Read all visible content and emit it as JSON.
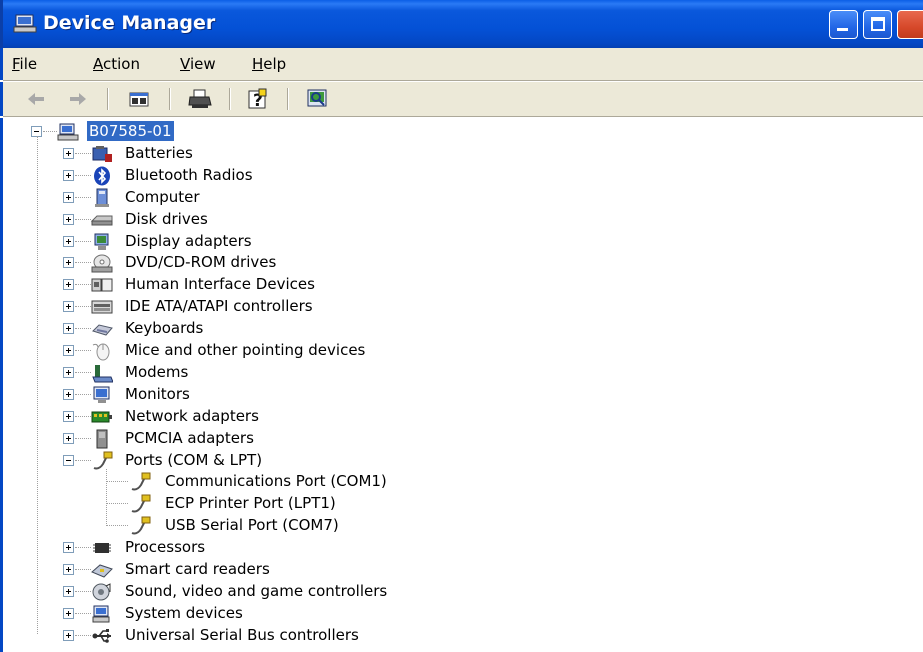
{
  "window": {
    "title": "Device Manager",
    "colors": {
      "titlebar": "#0451d6",
      "selection": "#316ac5",
      "chrome": "#ece9d8"
    }
  },
  "menu": [
    "File",
    "Action",
    "View",
    "Help"
  ],
  "toolbar": [
    "back-arrow-icon",
    "forward-arrow-icon",
    "show-hide-console-tree-icon",
    "print-icon",
    "help-icon",
    "scan-hardware-icon"
  ],
  "tree": {
    "root": "B07585-01",
    "categories": [
      {
        "label": "Batteries",
        "icon": "battery-icon"
      },
      {
        "label": "Bluetooth Radios",
        "icon": "bluetooth-icon"
      },
      {
        "label": "Computer",
        "icon": "computer-icon"
      },
      {
        "label": "Disk drives",
        "icon": "disk-drive-icon"
      },
      {
        "label": "Display adapters",
        "icon": "display-adapter-icon"
      },
      {
        "label": "DVD/CD-ROM drives",
        "icon": "cd-drive-icon"
      },
      {
        "label": "Human Interface Devices",
        "icon": "hid-icon"
      },
      {
        "label": "IDE ATA/ATAPI controllers",
        "icon": "ide-controller-icon"
      },
      {
        "label": "Keyboards",
        "icon": "keyboard-icon"
      },
      {
        "label": "Mice and other pointing devices",
        "icon": "mouse-icon"
      },
      {
        "label": "Modems",
        "icon": "modem-icon"
      },
      {
        "label": "Monitors",
        "icon": "monitor-icon"
      },
      {
        "label": "Network adapters",
        "icon": "network-adapter-icon"
      },
      {
        "label": "PCMCIA adapters",
        "icon": "pcmcia-icon"
      },
      {
        "label": "Ports (COM & LPT)",
        "icon": "port-icon",
        "expanded": true,
        "children": [
          {
            "label": "Communications Port (COM1)",
            "icon": "port-icon"
          },
          {
            "label": "ECP Printer Port (LPT1)",
            "icon": "port-icon"
          },
          {
            "label": "USB Serial Port (COM7)",
            "icon": "port-icon"
          }
        ]
      },
      {
        "label": "Processors",
        "icon": "processor-icon"
      },
      {
        "label": "Smart card readers",
        "icon": "smart-card-icon"
      },
      {
        "label": "Sound, video and game controllers",
        "icon": "sound-icon"
      },
      {
        "label": "System devices",
        "icon": "system-devices-icon"
      },
      {
        "label": "Universal Serial Bus controllers",
        "icon": "usb-icon"
      }
    ]
  }
}
